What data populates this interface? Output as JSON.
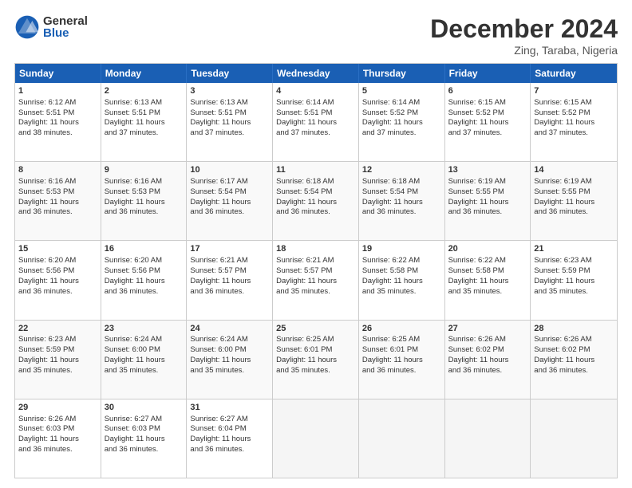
{
  "logo": {
    "general": "General",
    "blue": "Blue"
  },
  "title": "December 2024",
  "location": "Zing, Taraba, Nigeria",
  "days_of_week": [
    "Sunday",
    "Monday",
    "Tuesday",
    "Wednesday",
    "Thursday",
    "Friday",
    "Saturday"
  ],
  "weeks": [
    [
      {
        "day": "1",
        "sunrise": "6:12 AM",
        "sunset": "5:51 PM",
        "daylight": "11 hours and 38 minutes."
      },
      {
        "day": "2",
        "sunrise": "6:13 AM",
        "sunset": "5:51 PM",
        "daylight": "11 hours and 37 minutes."
      },
      {
        "day": "3",
        "sunrise": "6:13 AM",
        "sunset": "5:51 PM",
        "daylight": "11 hours and 37 minutes."
      },
      {
        "day": "4",
        "sunrise": "6:14 AM",
        "sunset": "5:51 PM",
        "daylight": "11 hours and 37 minutes."
      },
      {
        "day": "5",
        "sunrise": "6:14 AM",
        "sunset": "5:52 PM",
        "daylight": "11 hours and 37 minutes."
      },
      {
        "day": "6",
        "sunrise": "6:15 AM",
        "sunset": "5:52 PM",
        "daylight": "11 hours and 37 minutes."
      },
      {
        "day": "7",
        "sunrise": "6:15 AM",
        "sunset": "5:52 PM",
        "daylight": "11 hours and 37 minutes."
      }
    ],
    [
      {
        "day": "8",
        "sunrise": "6:16 AM",
        "sunset": "5:53 PM",
        "daylight": "11 hours and 36 minutes."
      },
      {
        "day": "9",
        "sunrise": "6:16 AM",
        "sunset": "5:53 PM",
        "daylight": "11 hours and 36 minutes."
      },
      {
        "day": "10",
        "sunrise": "6:17 AM",
        "sunset": "5:54 PM",
        "daylight": "11 hours and 36 minutes."
      },
      {
        "day": "11",
        "sunrise": "6:18 AM",
        "sunset": "5:54 PM",
        "daylight": "11 hours and 36 minutes."
      },
      {
        "day": "12",
        "sunrise": "6:18 AM",
        "sunset": "5:54 PM",
        "daylight": "11 hours and 36 minutes."
      },
      {
        "day": "13",
        "sunrise": "6:19 AM",
        "sunset": "5:55 PM",
        "daylight": "11 hours and 36 minutes."
      },
      {
        "day": "14",
        "sunrise": "6:19 AM",
        "sunset": "5:55 PM",
        "daylight": "11 hours and 36 minutes."
      }
    ],
    [
      {
        "day": "15",
        "sunrise": "6:20 AM",
        "sunset": "5:56 PM",
        "daylight": "11 hours and 36 minutes."
      },
      {
        "day": "16",
        "sunrise": "6:20 AM",
        "sunset": "5:56 PM",
        "daylight": "11 hours and 36 minutes."
      },
      {
        "day": "17",
        "sunrise": "6:21 AM",
        "sunset": "5:57 PM",
        "daylight": "11 hours and 36 minutes."
      },
      {
        "day": "18",
        "sunrise": "6:21 AM",
        "sunset": "5:57 PM",
        "daylight": "11 hours and 35 minutes."
      },
      {
        "day": "19",
        "sunrise": "6:22 AM",
        "sunset": "5:58 PM",
        "daylight": "11 hours and 35 minutes."
      },
      {
        "day": "20",
        "sunrise": "6:22 AM",
        "sunset": "5:58 PM",
        "daylight": "11 hours and 35 minutes."
      },
      {
        "day": "21",
        "sunrise": "6:23 AM",
        "sunset": "5:59 PM",
        "daylight": "11 hours and 35 minutes."
      }
    ],
    [
      {
        "day": "22",
        "sunrise": "6:23 AM",
        "sunset": "5:59 PM",
        "daylight": "11 hours and 35 minutes."
      },
      {
        "day": "23",
        "sunrise": "6:24 AM",
        "sunset": "6:00 PM",
        "daylight": "11 hours and 35 minutes."
      },
      {
        "day": "24",
        "sunrise": "6:24 AM",
        "sunset": "6:00 PM",
        "daylight": "11 hours and 35 minutes."
      },
      {
        "day": "25",
        "sunrise": "6:25 AM",
        "sunset": "6:01 PM",
        "daylight": "11 hours and 35 minutes."
      },
      {
        "day": "26",
        "sunrise": "6:25 AM",
        "sunset": "6:01 PM",
        "daylight": "11 hours and 36 minutes."
      },
      {
        "day": "27",
        "sunrise": "6:26 AM",
        "sunset": "6:02 PM",
        "daylight": "11 hours and 36 minutes."
      },
      {
        "day": "28",
        "sunrise": "6:26 AM",
        "sunset": "6:02 PM",
        "daylight": "11 hours and 36 minutes."
      }
    ],
    [
      {
        "day": "29",
        "sunrise": "6:26 AM",
        "sunset": "6:03 PM",
        "daylight": "11 hours and 36 minutes."
      },
      {
        "day": "30",
        "sunrise": "6:27 AM",
        "sunset": "6:03 PM",
        "daylight": "11 hours and 36 minutes."
      },
      {
        "day": "31",
        "sunrise": "6:27 AM",
        "sunset": "6:04 PM",
        "daylight": "11 hours and 36 minutes."
      },
      null,
      null,
      null,
      null
    ]
  ],
  "labels": {
    "sunrise": "Sunrise:",
    "sunset": "Sunset:",
    "daylight": "Daylight:"
  }
}
